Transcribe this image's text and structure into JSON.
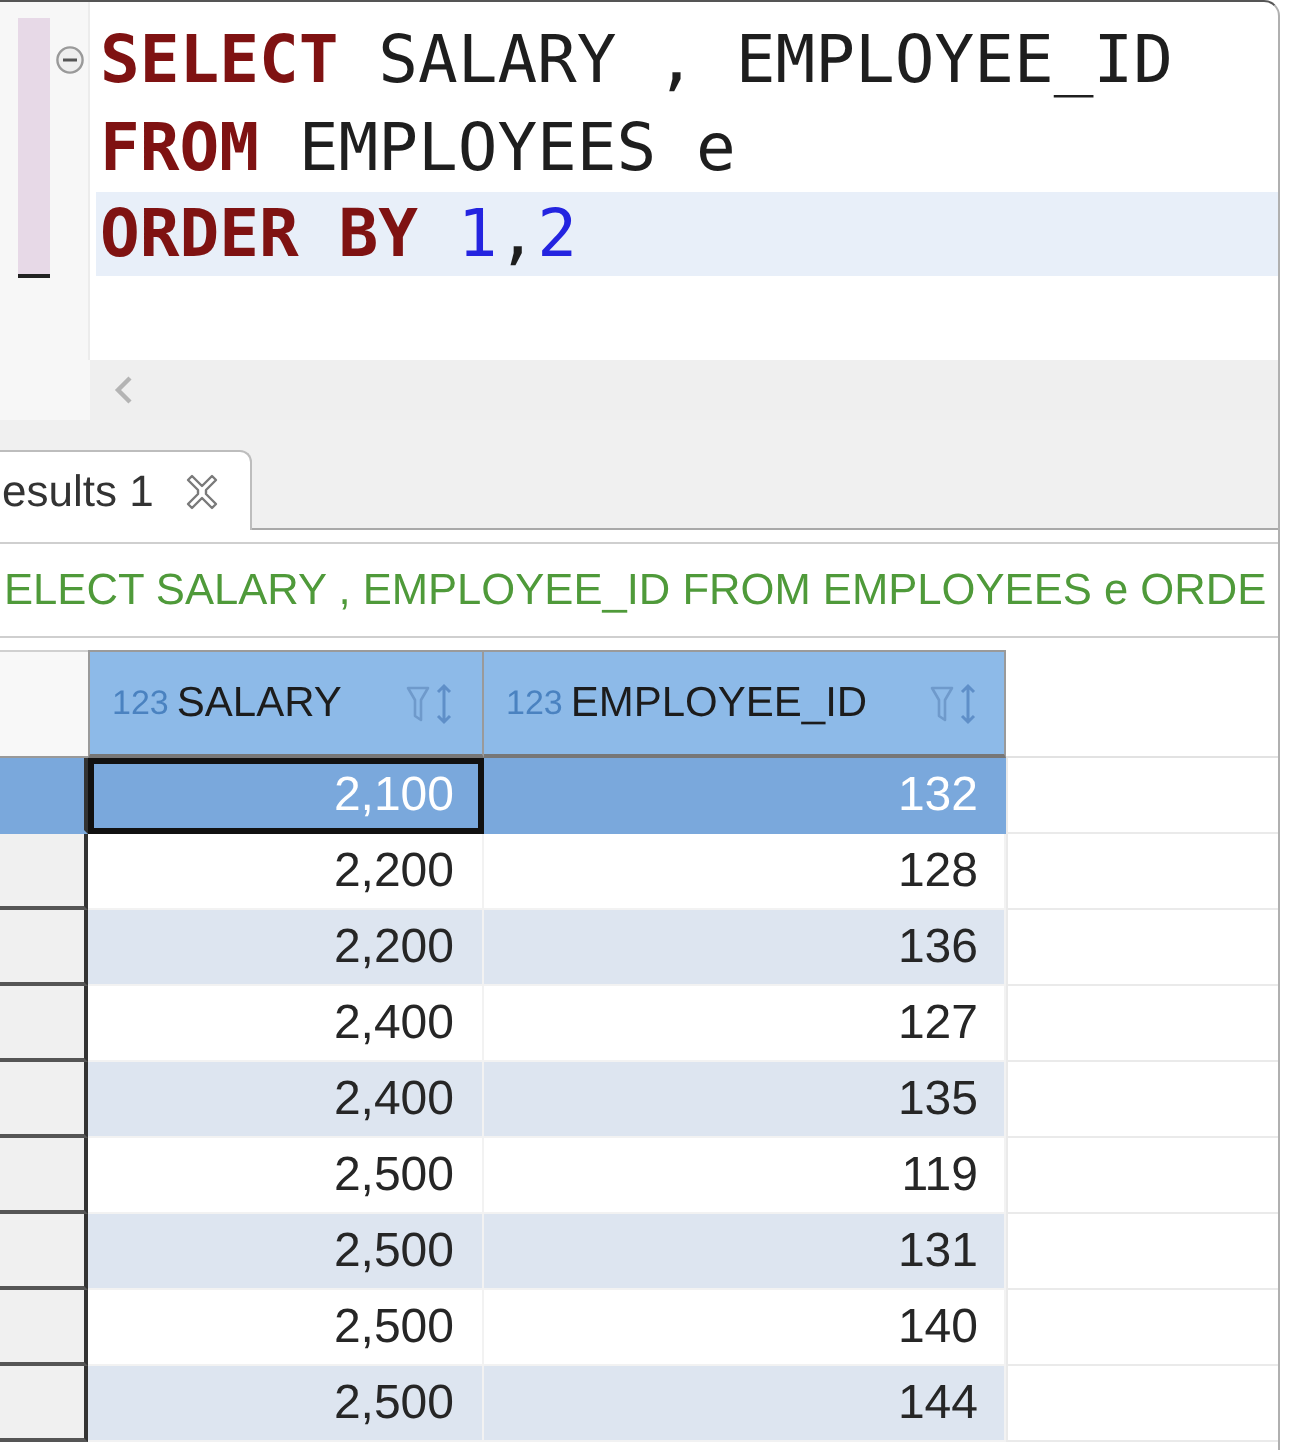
{
  "editor": {
    "fold_expanded": true,
    "lines": [
      {
        "current": false,
        "tokens": [
          {
            "kind": "keyword",
            "text": "SELECT"
          },
          {
            "kind": "identifier",
            "text": " SALARY , EMPLOYEE_ID"
          }
        ]
      },
      {
        "current": false,
        "tokens": [
          {
            "kind": "keyword",
            "text": "FROM"
          },
          {
            "kind": "identifier",
            "text": " EMPLOYEES e"
          }
        ]
      },
      {
        "current": true,
        "tokens": [
          {
            "kind": "keyword",
            "text": "ORDER BY"
          },
          {
            "kind": "number",
            "text": " 1"
          },
          {
            "kind": "punctuation",
            "text": ","
          },
          {
            "kind": "number",
            "text": "2"
          }
        ]
      }
    ]
  },
  "results_tabs": [
    {
      "label": "esults 1",
      "selected": true
    }
  ],
  "query_text": "ELECT SALARY , EMPLOYEE_ID FROM EMPLOYEES e ORDE",
  "grid": {
    "columns": [
      {
        "type": "123",
        "name": "SALARY"
      },
      {
        "type": "123",
        "name": "EMPLOYEE_ID"
      }
    ],
    "rows": [
      {
        "selected": true,
        "cells": [
          {
            "text": "2,100",
            "focused": true
          },
          {
            "text": "132",
            "focused": false
          }
        ]
      },
      {
        "selected": false,
        "cells": [
          {
            "text": "2,200",
            "focused": false
          },
          {
            "text": "128",
            "focused": false
          }
        ]
      },
      {
        "selected": false,
        "cells": [
          {
            "text": "2,200",
            "focused": false
          },
          {
            "text": "136",
            "focused": false
          }
        ]
      },
      {
        "selected": false,
        "cells": [
          {
            "text": "2,400",
            "focused": false
          },
          {
            "text": "127",
            "focused": false
          }
        ]
      },
      {
        "selected": false,
        "cells": [
          {
            "text": "2,400",
            "focused": false
          },
          {
            "text": "135",
            "focused": false
          }
        ]
      },
      {
        "selected": false,
        "cells": [
          {
            "text": "2,500",
            "focused": false
          },
          {
            "text": "119",
            "focused": false
          }
        ]
      },
      {
        "selected": false,
        "cells": [
          {
            "text": "2,500",
            "focused": false
          },
          {
            "text": "131",
            "focused": false
          }
        ]
      },
      {
        "selected": false,
        "cells": [
          {
            "text": "2,500",
            "focused": false
          },
          {
            "text": "140",
            "focused": false
          }
        ]
      },
      {
        "selected": false,
        "cells": [
          {
            "text": "2,500",
            "focused": false
          },
          {
            "text": "144",
            "focused": false
          }
        ]
      }
    ]
  }
}
